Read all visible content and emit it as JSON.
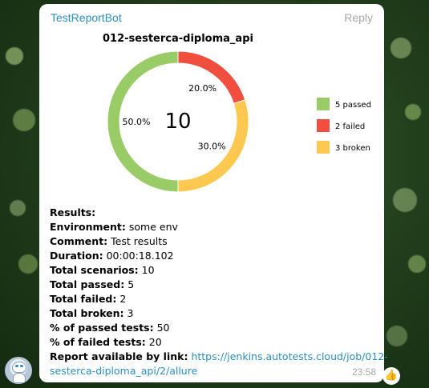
{
  "message": {
    "sender": "TestReportBot",
    "reply_label": "Reply",
    "time": "23:58",
    "reaction_icon": "thumbs-up-icon",
    "avatar_icon": "robot-avatar-icon"
  },
  "chart_data": {
    "type": "pie",
    "title": "012-sesterca-diploma_api",
    "center_label": "10",
    "slices": [
      {
        "label": "passed",
        "value": 5,
        "percent_label": "50.0%",
        "color": "#99cc66"
      },
      {
        "label": "failed",
        "value": 2,
        "percent_label": "20.0%",
        "color": "#f04e3e"
      },
      {
        "label": "broken",
        "value": 3,
        "percent_label": "30.0%",
        "color": "#fdc84f"
      }
    ],
    "legend": [
      "5 passed",
      "2 failed",
      "3 broken"
    ],
    "legend_position": "right"
  },
  "report": {
    "results_label": "Results:",
    "environment_label": "Environment:",
    "environment_value": "some env",
    "comment_label": "Comment:",
    "comment_value": "Test results",
    "duration_label": "Duration:",
    "duration_value": "00:00:18.102",
    "total_scenarios_label": "Total scenarios:",
    "total_scenarios_value": "10",
    "total_passed_label": "Total passed:",
    "total_passed_value": "5",
    "total_failed_label": "Total failed:",
    "total_failed_value": "2",
    "total_broken_label": "Total broken:",
    "total_broken_value": "3",
    "pct_passed_label": "% of passed tests:",
    "pct_passed_value": "50",
    "pct_failed_label": "% of failed tests:",
    "pct_failed_value": "20",
    "link_label": "Report available by link:",
    "link_line1": "https://jenkins.autotests.cloud/job/012-",
    "link_line2": "sesterca-diploma_api/2/allure"
  }
}
